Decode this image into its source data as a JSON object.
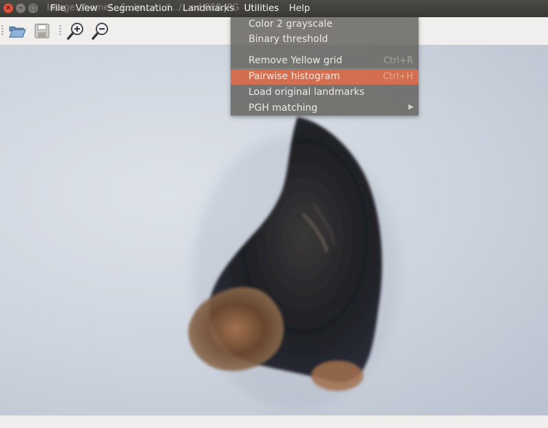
{
  "window": {
    "title": "Image: /home/...F.../m.../.../l.../...ed 028.JPG",
    "buttons": [
      "close",
      "minimize",
      "maximize"
    ]
  },
  "menubar": {
    "items": [
      {
        "label": "File"
      },
      {
        "label": "View"
      },
      {
        "label": "Segmentation"
      },
      {
        "label": "Landmarks"
      },
      {
        "label": "Utilities"
      },
      {
        "label": "Help"
      }
    ],
    "open_menu": "Utilities"
  },
  "toolbar": {
    "icons": [
      "open-folder-icon",
      "save-icon",
      "zoom-in-icon",
      "zoom-out-icon"
    ]
  },
  "dropdown": {
    "items": [
      {
        "label": "Color 2 grayscale",
        "shortcut": ""
      },
      {
        "label": "Binary threshold",
        "shortcut": ""
      },
      {
        "label": "Remove Yellow grid",
        "shortcut": "Ctrl+R"
      },
      {
        "label": "Pairwise histogram",
        "shortcut": "Ctrl+H",
        "highlighted": true
      },
      {
        "label": "Load original landmarks",
        "shortcut": ""
      },
      {
        "label": "PGH matching",
        "shortcut": "",
        "submenu": true
      }
    ]
  },
  "colors": {
    "titlebar": "#3d3c38",
    "menu_highlight": "#e96d4b",
    "toolbar": "#f0efed",
    "close_button": "#e0533a"
  }
}
